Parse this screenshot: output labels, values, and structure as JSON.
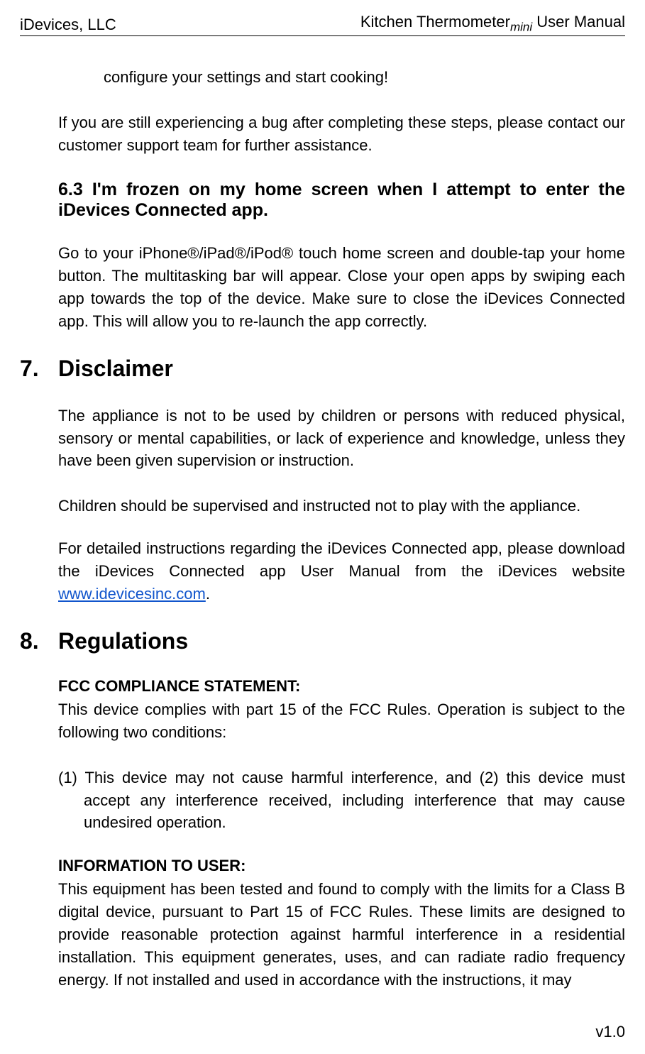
{
  "header": {
    "left": "iDevices, LLC",
    "right_prefix": "Kitchen Thermometer",
    "right_sub": "mini",
    "right_suffix": " User Manual"
  },
  "body": {
    "p1": "configure your settings and start cooking!",
    "p2": "If you are still experiencing a bug after completing these steps, please contact our customer support team for further assistance.",
    "h63": "6.3  I'm frozen on my home screen when I attempt to enter the iDevices Connected app.",
    "p3": "Go to your iPhone®/iPad®/iPod® touch home screen and double-tap your home button. The multitasking bar will appear. Close your open apps by swiping each app towards the top of the device. Make sure to close the iDevices Connected app. This will allow you to re-launch the app correctly.",
    "h7_num": "7.",
    "h7_title": "Disclaimer",
    "p4": "The appliance is not to be used by children or persons with reduced physical, sensory or mental capabilities, or lack of experience and knowledge, unless they have been given supervision or instruction.",
    "p5": "Children should be supervised and instructed not to play with the appliance.",
    "p6_before": "For detailed instructions regarding the iDevices Connected app, please download the iDevices Connected app User Manual from the iDevices website ",
    "p6_link": "www.idevicesinc.com",
    "p6_after": ".",
    "h8_num": "8.",
    "h8_title": "Regulations",
    "fcc_head": "FCC COMPLIANCE STATEMENT:",
    "fcc_p1": "This device complies with part 15 of the FCC Rules.  Operation is subject to the following two conditions:",
    "fcc_li": "(1) This device may not cause harmful interference, and (2) this device must accept any interference received, including interference that may cause undesired operation.",
    "info_head": "INFORMATION TO USER:",
    "info_p": "This equipment has been tested and found to comply with the limits for a Class B digital device, pursuant to Part 15 of FCC Rules.  These limits are designed to provide reasonable protection against harmful interference in a residential installation.  This equipment generates, uses, and can radiate radio frequency energy.  If not installed and used in accordance with the instructions, it may"
  },
  "footer": {
    "version": "v1.0"
  }
}
